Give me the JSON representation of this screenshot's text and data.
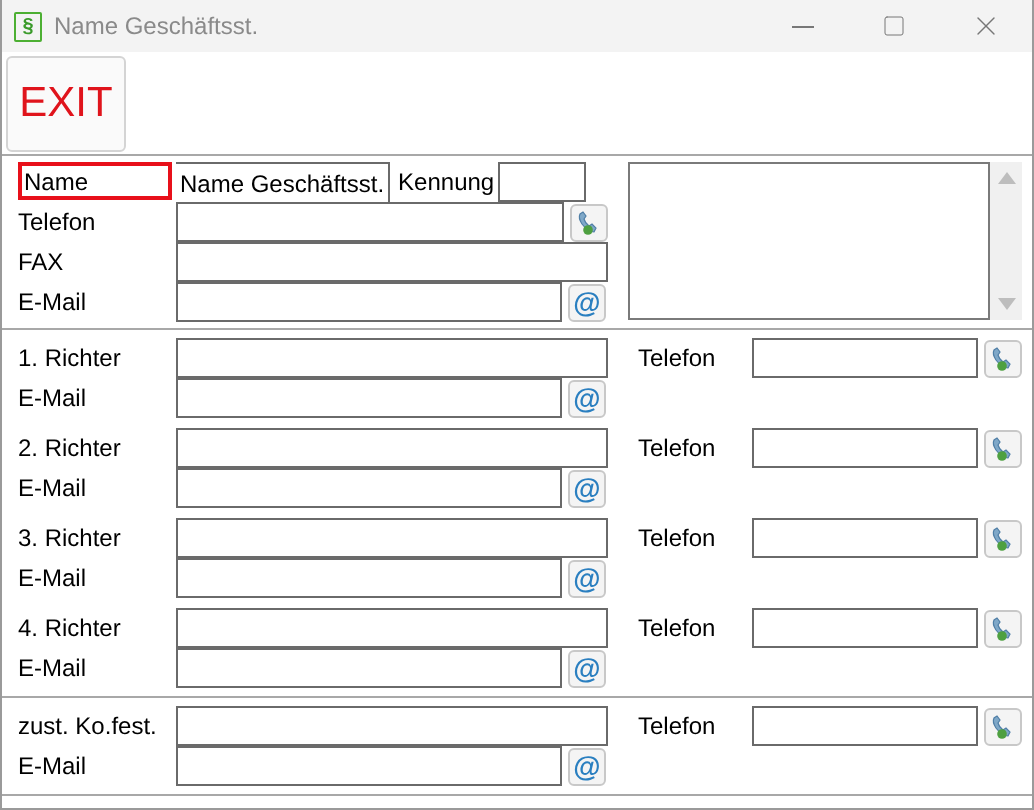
{
  "window": {
    "icon_glyph": "§",
    "title": "Name Geschäftsst."
  },
  "toolbar": {
    "exit_button": "EXIT"
  },
  "office": {
    "name_label": {
      "text": "Name",
      "highlighted": true
    },
    "name_value": "Name Geschäftsst.",
    "id_label": "Kennung",
    "phone_label": "Telefon",
    "fax_label": "FAX",
    "email_label": "E-Mail",
    "email_button": "@"
  },
  "contact_groups": [
    {
      "contacts": [
        {
          "label": "1. Richter",
          "phone_label": "Telefon",
          "email_label": "E-Mail",
          "email_button": "@"
        },
        {
          "label": "2. Richter",
          "phone_label": "Telefon",
          "email_label": "E-Mail",
          "email_button": "@"
        },
        {
          "label": "3. Richter",
          "phone_label": "Telefon",
          "email_label": "E-Mail",
          "email_button": "@"
        },
        {
          "label": "4. Richter",
          "phone_label": "Telefon",
          "email_label": "E-Mail",
          "email_button": "@"
        }
      ]
    },
    {
      "contacts": [
        {
          "label": "zust. Ko.fest.",
          "phone_label": "Telefon",
          "email_label": "E-Mail",
          "email_button": "@"
        }
      ]
    }
  ]
}
